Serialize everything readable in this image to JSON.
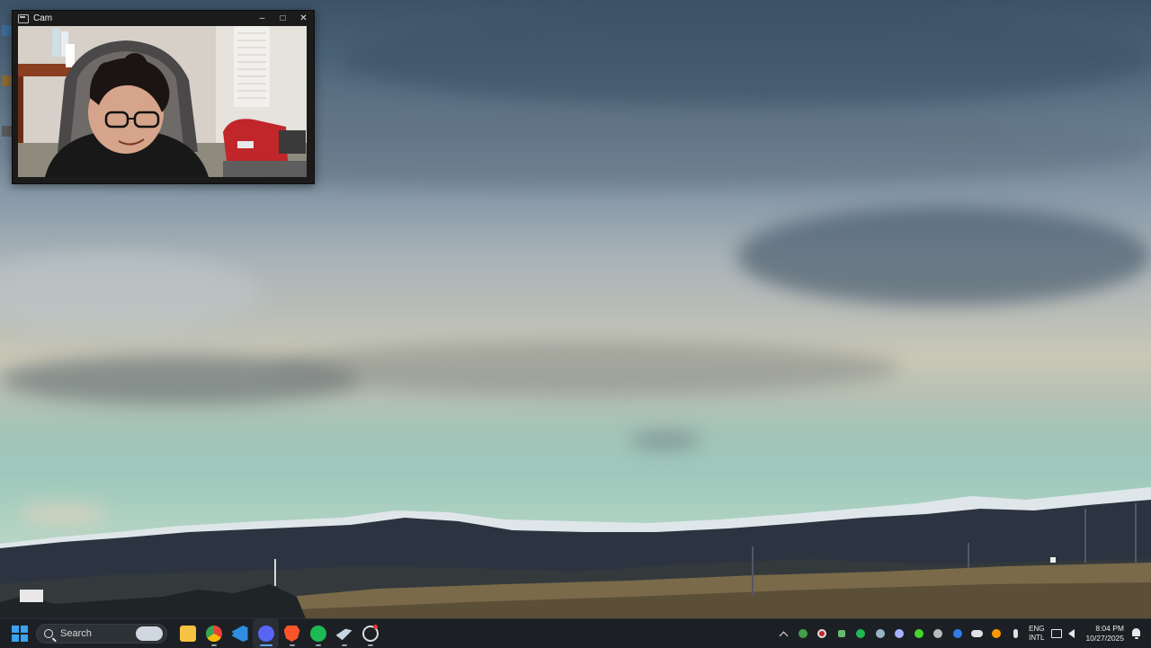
{
  "cam_window": {
    "title": "Cam",
    "minimize_glyph": "–",
    "maximize_glyph": "□",
    "close_glyph": "✕"
  },
  "taskbar": {
    "search_label": "Search",
    "pinned_apps": [
      {
        "name": "file-explorer",
        "color": "#f5c242"
      },
      {
        "name": "chrome",
        "color": "#4285f4"
      },
      {
        "name": "vscode",
        "color": "#2f8ee0"
      },
      {
        "name": "discord",
        "color": "#5865f2"
      },
      {
        "name": "brave",
        "color": "#fb542b"
      },
      {
        "name": "spotify",
        "color": "#1db954"
      },
      {
        "name": "steam",
        "color": "#1b2838"
      },
      {
        "name": "obs",
        "color": "#dddddd"
      }
    ],
    "tray": {
      "language_top": "ENG",
      "language_bottom": "INTL",
      "time": "8:04 PM",
      "date": "10/27/2025"
    }
  }
}
